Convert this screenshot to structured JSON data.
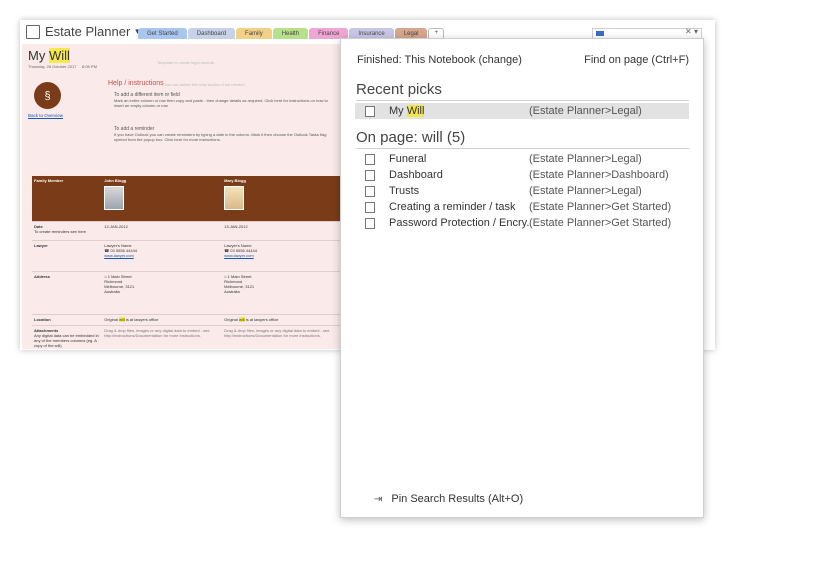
{
  "notebook": {
    "title": "Estate Planner",
    "dropdown_glyph": "▾"
  },
  "tabs": [
    {
      "label": "Get Started",
      "color": "#a9c6ef"
    },
    {
      "label": "Dashboard",
      "color": "#c7d2e6"
    },
    {
      "label": "Family",
      "color": "#f2d087"
    },
    {
      "label": "Health",
      "color": "#b7e08a"
    },
    {
      "label": "Finance",
      "color": "#f0a6d4"
    },
    {
      "label": "Insurance",
      "color": "#c8c8e6"
    },
    {
      "label": "Legal",
      "color": "#d8a78f"
    },
    {
      "label": "+",
      "color": "#ffffff"
    }
  ],
  "search": {
    "clear_glyph": "✕ ▾"
  },
  "page": {
    "title_prefix": "My ",
    "title_highlight": "Will",
    "date": "Thursday, 26 October 2017",
    "time": "8:05 PM",
    "template_note": "Template to create legal records",
    "back_link": "Back to Overview",
    "help_title": "Help / instructions",
    "help_sub": "- You can delete this help section if not needed",
    "help_items": [
      {
        "title": "To add a different item or field",
        "body": "Mark an entire column or row then copy and paste - then change details as required. Click here for instructions on how to insert an empty column or row."
      },
      {
        "title": "To add a reminder",
        "body": "If you have Outlook you can create reminders by typing a date in the column. Mark it then choose the Outlook Tasks flag symbol from the popup box. Click here for more instructions."
      }
    ],
    "grid": {
      "header": {
        "label": "Family Member",
        "c1": "John Blogg",
        "c2": "Mary Blogg"
      },
      "date": {
        "label": "Date",
        "sub": "To create reminders see here",
        "c1": "12-JAN-2012",
        "c2": "13-JAN-2012"
      },
      "lawyer": {
        "label": "Lawyer",
        "name": "Lawyer's Name",
        "phone": "03 5556 44444",
        "web": "www.lawyer.com"
      },
      "address": {
        "label": "Address",
        "lines": [
          "1 Main Street",
          "Richmond",
          "Melbourne, 3121",
          "Australia"
        ]
      },
      "location": {
        "label": "Location",
        "prefix": "Original ",
        "hl": "will",
        "suffix": " is at lawyers office"
      },
      "attachments": {
        "label": "Attachments",
        "sub": "Any digital data can be embedded in any of the members columns (eg. A copy of the will)",
        "body": "Drag & drop files, images or any digital data to embed - see http://instructions/Documentation for more instructions."
      }
    }
  },
  "popup": {
    "finished": "Finished:  This Notebook (change)",
    "find_on_page": "Find on page (Ctrl+F)",
    "recent_title": "Recent picks",
    "recent": [
      {
        "prefix": "My ",
        "hl": "Will",
        "path": "(Estate Planner>Legal)"
      }
    ],
    "onpage_title": "On page:  will (5)",
    "results": [
      {
        "name": "Funeral",
        "path": "(Estate Planner>Legal)"
      },
      {
        "name": "Dashboard",
        "path": "(Estate Planner>Dashboard)"
      },
      {
        "name": "Trusts",
        "path": "(Estate Planner>Legal)"
      },
      {
        "name": "Creating a reminder / task",
        "path": "(Estate Planner>Get Started)"
      },
      {
        "name": "Password Protection / Encry...",
        "path": "(Estate Planner>Get Started)"
      }
    ],
    "pin_label": "Pin Search Results (Alt+O)"
  },
  "icons": [
    "notebook-icon",
    "page-icon",
    "pin-icon",
    "logo-icon",
    "phone-icon",
    "web-icon",
    "home-icon"
  ],
  "colors": {
    "header_brown": "#7a3c18",
    "page_bg": "#fbeaea",
    "highlight": "#f2e64a",
    "selection": "#e2e2e2"
  }
}
